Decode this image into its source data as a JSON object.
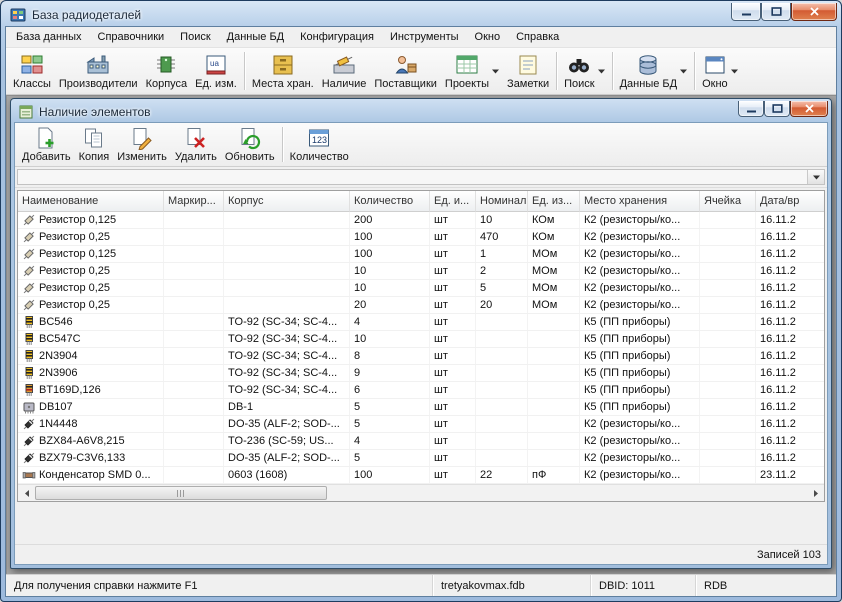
{
  "window": {
    "title": "База радиодеталей",
    "icon": "app-icon",
    "buttons": [
      {
        "name": "minimize",
        "icon": "minimize-icon"
      },
      {
        "name": "maximize",
        "icon": "maximize-icon"
      },
      {
        "name": "close",
        "icon": "close-icon"
      }
    ]
  },
  "menu": {
    "items": [
      "База данных",
      "Справочники",
      "Поиск",
      "Данные БД",
      "Конфигурация",
      "Инструменты",
      "Окно",
      "Справка"
    ]
  },
  "toolbar": {
    "dropdown_arrow_icon": "dropdown-arrow-icon",
    "items": [
      {
        "label": "Классы",
        "icon": "classes-icon",
        "dropdown": false,
        "sep_after": false
      },
      {
        "label": "Производители",
        "icon": "manufacturers-icon",
        "dropdown": false,
        "sep_after": false
      },
      {
        "label": "Корпуса",
        "icon": "packages-icon",
        "dropdown": false,
        "sep_after": false
      },
      {
        "label": "Ед. изм.",
        "icon": "units-icon",
        "dropdown": false,
        "sep_after": true
      },
      {
        "label": "Места хран.",
        "icon": "storage-icon",
        "dropdown": false,
        "sep_after": false
      },
      {
        "label": "Наличие",
        "icon": "stock-icon",
        "dropdown": false,
        "sep_after": false
      },
      {
        "label": "Поставщики",
        "icon": "suppliers-icon",
        "dropdown": false,
        "sep_after": false
      },
      {
        "label": "Проекты",
        "icon": "projects-icon",
        "dropdown": true,
        "sep_after": false
      },
      {
        "label": "Заметки",
        "icon": "notes-icon",
        "dropdown": false,
        "sep_after": true
      },
      {
        "label": "Поиск",
        "icon": "search-icon",
        "dropdown": true,
        "sep_after": true
      },
      {
        "label": "Данные БД",
        "icon": "dbdata-icon",
        "dropdown": true,
        "sep_after": true
      },
      {
        "label": "Окно",
        "icon": "window-icon",
        "dropdown": true,
        "sep_after": false
      }
    ]
  },
  "child_window": {
    "title": "Наличие элементов",
    "icon": "form-icon",
    "buttons": [
      {
        "name": "minimize",
        "icon": "minimize-icon"
      },
      {
        "name": "maximize",
        "icon": "maximize-icon"
      },
      {
        "name": "close",
        "icon": "close-icon"
      }
    ],
    "toolbar": [
      {
        "label": "Добавить",
        "icon": "add-icon",
        "dropdown": false,
        "sep_after": false
      },
      {
        "label": "Копия",
        "icon": "copy-icon",
        "dropdown": false,
        "sep_after": false
      },
      {
        "label": "Изменить",
        "icon": "edit-icon",
        "dropdown": false,
        "sep_after": false
      },
      {
        "label": "Удалить",
        "icon": "delete-icon",
        "dropdown": false,
        "sep_after": false
      },
      {
        "label": "Обновить",
        "icon": "refresh-icon",
        "dropdown": false,
        "sep_after": true
      },
      {
        "label": "Количество",
        "icon": "quantity-icon",
        "dropdown": false,
        "sep_after": false
      }
    ],
    "filter_value": "",
    "combo_arrow_icon": "combo-arrow-icon",
    "scrollbar": {
      "left_icon": "scroll-left-icon",
      "right_icon": "scroll-right-icon",
      "grip_icon": "grip-icon"
    },
    "status": "Записей 103",
    "table": {
      "columns": [
        {
          "label": "Наименование",
          "key": "name"
        },
        {
          "label": "Маркир...",
          "key": "marking"
        },
        {
          "label": "Корпус",
          "key": "package"
        },
        {
          "label": "Количество",
          "key": "qty"
        },
        {
          "label": "Ед. и...",
          "key": "unit"
        },
        {
          "label": "Номинал",
          "key": "nominal"
        },
        {
          "label": "Ед. из...",
          "key": "nominal_unit"
        },
        {
          "label": "Место хранения",
          "key": "location"
        },
        {
          "label": "Ячейка",
          "key": "cell"
        },
        {
          "label": "Дата/вр",
          "key": "date"
        }
      ],
      "rows": [
        {
          "icon": "resistor-icon",
          "name": "Резистор 0,125",
          "marking": "",
          "package": "",
          "qty": "200",
          "unit": "шт",
          "nominal": "10",
          "nominal_unit": "КОм",
          "location": "К2 (резисторы/ко...",
          "cell": "",
          "date": "16.11.2"
        },
        {
          "icon": "resistor-icon",
          "name": "Резистор 0,25",
          "marking": "",
          "package": "",
          "qty": "100",
          "unit": "шт",
          "nominal": "470",
          "nominal_unit": "КОм",
          "location": "К2 (резисторы/ко...",
          "cell": "",
          "date": "16.11.2"
        },
        {
          "icon": "resistor-icon",
          "name": "Резистор 0,125",
          "marking": "",
          "package": "",
          "qty": "100",
          "unit": "шт",
          "nominal": "1",
          "nominal_unit": "МОм",
          "location": "К2 (резисторы/ко...",
          "cell": "",
          "date": "16.11.2"
        },
        {
          "icon": "resistor-icon",
          "name": "Резистор 0,25",
          "marking": "",
          "package": "",
          "qty": "10",
          "unit": "шт",
          "nominal": "2",
          "nominal_unit": "МОм",
          "location": "К2 (резисторы/ко...",
          "cell": "",
          "date": "16.11.2"
        },
        {
          "icon": "resistor-icon",
          "name": "Резистор 0,25",
          "marking": "",
          "package": "",
          "qty": "10",
          "unit": "шт",
          "nominal": "5",
          "nominal_unit": "МОм",
          "location": "К2 (резисторы/ко...",
          "cell": "",
          "date": "16.11.2"
        },
        {
          "icon": "resistor-icon",
          "name": "Резистор 0,25",
          "marking": "",
          "package": "",
          "qty": "20",
          "unit": "шт",
          "nominal": "20",
          "nominal_unit": "МОм",
          "location": "К2 (резисторы/ко...",
          "cell": "",
          "date": "16.11.2"
        },
        {
          "icon": "transistor-icon",
          "name": "BC546",
          "marking": "",
          "package": "TO-92 (SC-34; SC-4...",
          "qty": "4",
          "unit": "шт",
          "nominal": "",
          "nominal_unit": "",
          "location": "К5 (ПП приборы)",
          "cell": "",
          "date": "16.11.2"
        },
        {
          "icon": "transistor-icon",
          "name": "BC547C",
          "marking": "",
          "package": "TO-92 (SC-34; SC-4...",
          "qty": "10",
          "unit": "шт",
          "nominal": "",
          "nominal_unit": "",
          "location": "К5 (ПП приборы)",
          "cell": "",
          "date": "16.11.2"
        },
        {
          "icon": "transistor-icon",
          "name": "2N3904",
          "marking": "",
          "package": "TO-92 (SC-34; SC-4...",
          "qty": "8",
          "unit": "шт",
          "nominal": "",
          "nominal_unit": "",
          "location": "К5 (ПП приборы)",
          "cell": "",
          "date": "16.11.2"
        },
        {
          "icon": "transistor-icon",
          "name": "2N3906",
          "marking": "",
          "package": "TO-92 (SC-34; SC-4...",
          "qty": "9",
          "unit": "шт",
          "nominal": "",
          "nominal_unit": "",
          "location": "К5 (ПП приборы)",
          "cell": "",
          "date": "16.11.2"
        },
        {
          "icon": "thyristor-icon",
          "name": "BT169D,126",
          "marking": "",
          "package": "TO-92 (SC-34; SC-4...",
          "qty": "6",
          "unit": "шт",
          "nominal": "",
          "nominal_unit": "",
          "location": "К5 (ПП приборы)",
          "cell": "",
          "date": "16.11.2"
        },
        {
          "icon": "bridge-icon",
          "name": "DB107",
          "marking": "",
          "package": "DB-1",
          "qty": "5",
          "unit": "шт",
          "nominal": "",
          "nominal_unit": "",
          "location": "К5 (ПП приборы)",
          "cell": "",
          "date": "16.11.2"
        },
        {
          "icon": "diode-icon",
          "name": "1N4448",
          "marking": "",
          "package": "DO-35 (ALF-2; SOD-...",
          "qty": "5",
          "unit": "шт",
          "nominal": "",
          "nominal_unit": "",
          "location": "К2 (резисторы/ко...",
          "cell": "",
          "date": "16.11.2"
        },
        {
          "icon": "diode-icon",
          "name": "BZX84-A6V8,215",
          "marking": "",
          "package": "TO-236 (SC-59; US...",
          "qty": "4",
          "unit": "шт",
          "nominal": "",
          "nominal_unit": "",
          "location": "К2 (резисторы/ко...",
          "cell": "",
          "date": "16.11.2"
        },
        {
          "icon": "diode-icon",
          "name": "BZX79-C3V6,133",
          "marking": "",
          "package": "DO-35 (ALF-2; SOD-...",
          "qty": "5",
          "unit": "шт",
          "nominal": "",
          "nominal_unit": "",
          "location": "К2 (резисторы/ко...",
          "cell": "",
          "date": "16.11.2"
        },
        {
          "icon": "capacitor-icon",
          "name": "Конденсатор SMD 0...",
          "marking": "",
          "package": "0603 (1608)",
          "qty": "100",
          "unit": "шт",
          "nominal": "22",
          "nominal_unit": "пФ",
          "location": "К2 (резисторы/ко...",
          "cell": "",
          "date": "23.11.2"
        }
      ]
    }
  },
  "statusbar": {
    "help": "Для получения справки нажмите F1",
    "db_file": "tretyakovmax.fdb",
    "dbid": "DBID: 1011",
    "role": "RDB"
  },
  "colors": {
    "titlebar_blue": "#b7cfe9",
    "workspace_gray": "#a6a6a6",
    "close_button_red": "#d35b33",
    "table_white": "#ffffff"
  }
}
